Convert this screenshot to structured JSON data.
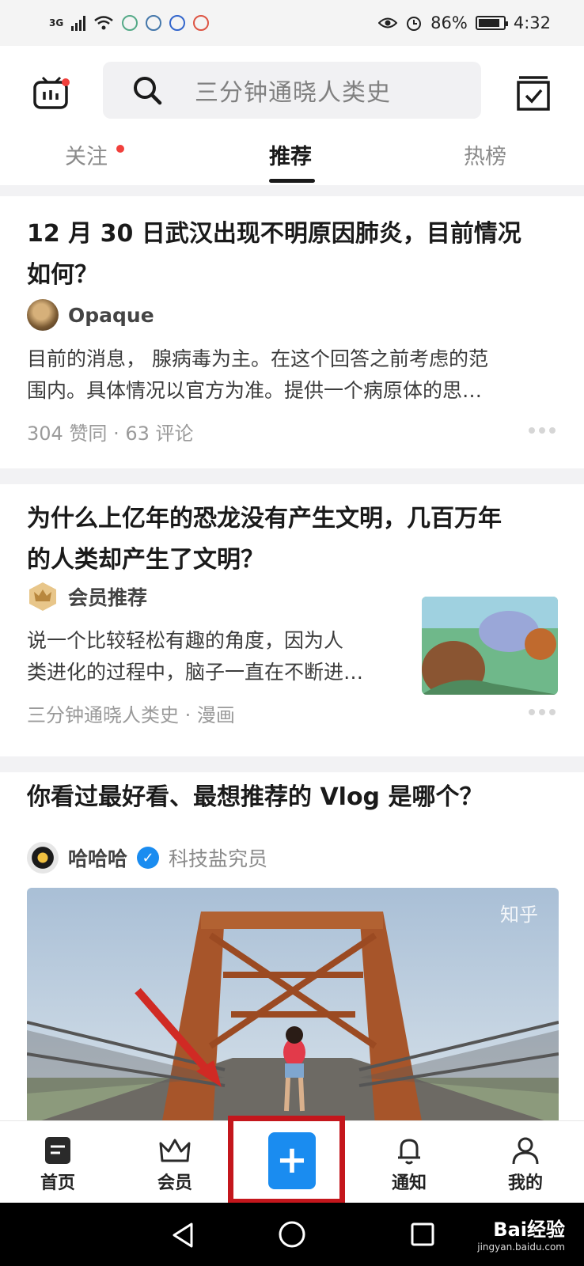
{
  "status_bar": {
    "network": "3G",
    "battery": "86%",
    "time": "4:32"
  },
  "header": {
    "search_placeholder": "三分钟通晓人类史",
    "tabs": [
      {
        "label": "关注",
        "has_dot": true
      },
      {
        "label": "推荐",
        "active": true
      },
      {
        "label": "热榜"
      }
    ]
  },
  "feed": [
    {
      "title_line1": "12 月 30 日武汉出现不明原因肺炎，目前情况",
      "title_line2": "如何？",
      "author": "Opaque",
      "excerpt_line1": "目前的消息， 腺病毒为主。在这个回答之前考虑的范",
      "excerpt_line2": "围内。具体情况以官方为准。提供一个病原体的思…",
      "meta": "304 赞同 · 63 评论"
    },
    {
      "title_line1": "为什么上亿年的恐龙没有产生文明，几百万年",
      "title_line2": "的人类却产生了文明？",
      "author": "会员推荐",
      "excerpt_line1": "说一个比较轻松有趣的角度，因为人",
      "excerpt_line2": "类进化的过程中，脑子一直在不断进…",
      "meta": "三分钟通晓人类史 · 漫画"
    },
    {
      "title": "你看过最好看、最想推荐的 Vlog 是哪个？",
      "author": "哈哈哈",
      "author_tag": "科技盐究员",
      "watermark": "知乎"
    }
  ],
  "bottom_nav": {
    "items": [
      {
        "label": "首页",
        "icon": "home-icon"
      },
      {
        "label": "会员",
        "icon": "crown-icon"
      },
      {
        "label": "+",
        "icon": "plus-icon"
      },
      {
        "label": "通知",
        "icon": "bell-icon"
      },
      {
        "label": "我的",
        "icon": "profile-icon"
      }
    ]
  },
  "watermark_brand": {
    "name": "Bai经验",
    "url": "jingyan.baidu.com"
  },
  "colors": {
    "accent": "#1a8cf0",
    "dot": "#f1403c",
    "highlight": "#c4161c"
  }
}
